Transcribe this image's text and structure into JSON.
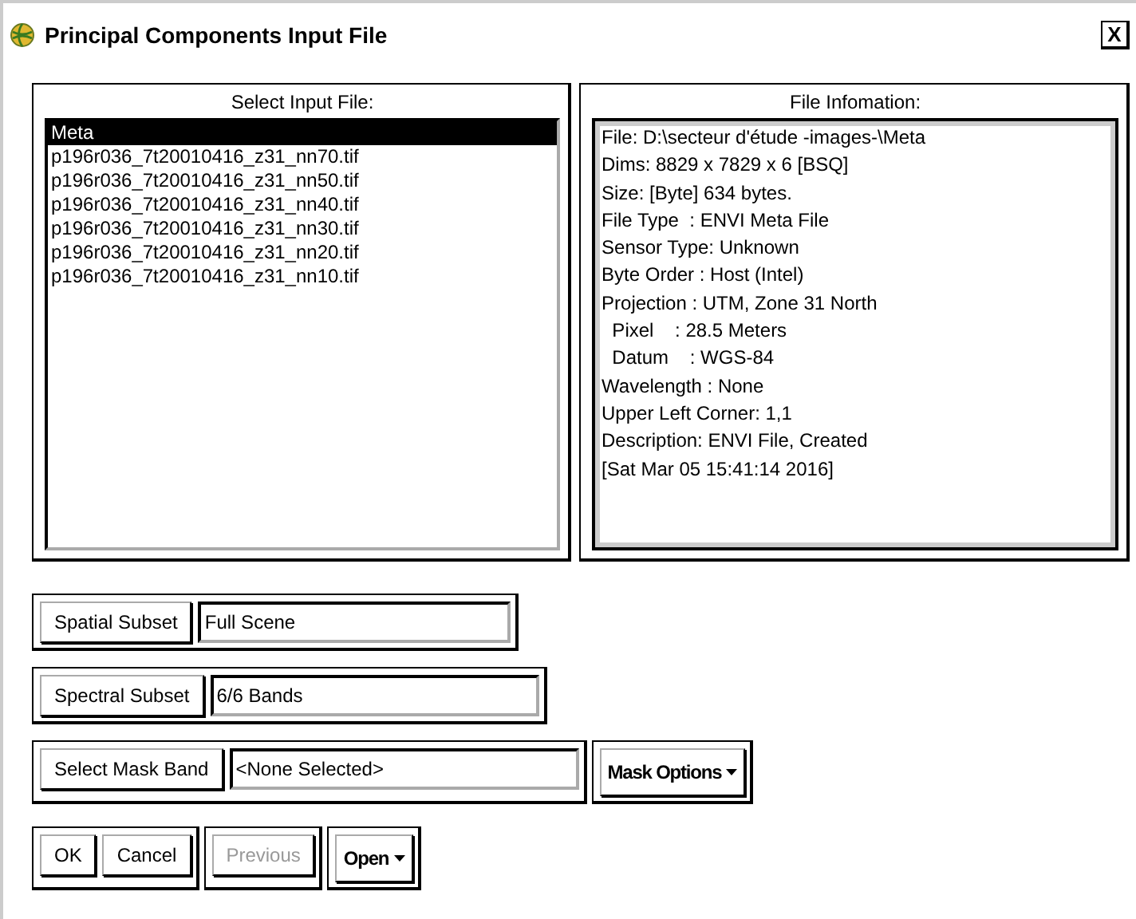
{
  "window": {
    "title": "Principal Components Input File",
    "close": "X"
  },
  "input_files": {
    "heading": "Select Input File:",
    "items": [
      {
        "name": "Meta",
        "selected": true
      },
      {
        "name": "p196r036_7t20010416_z31_nn70.tif",
        "selected": false
      },
      {
        "name": "p196r036_7t20010416_z31_nn50.tif",
        "selected": false
      },
      {
        "name": "p196r036_7t20010416_z31_nn40.tif",
        "selected": false
      },
      {
        "name": "p196r036_7t20010416_z31_nn30.tif",
        "selected": false
      },
      {
        "name": "p196r036_7t20010416_z31_nn20.tif",
        "selected": false
      },
      {
        "name": "p196r036_7t20010416_z31_nn10.tif",
        "selected": false
      }
    ]
  },
  "file_information": {
    "heading": "File Infomation:",
    "lines": [
      "File: D:\\secteur d'étude -images-\\Meta",
      "Dims: 8829 x 7829 x 6 [BSQ]",
      "Size: [Byte] 634 bytes.",
      "File Type  : ENVI Meta File",
      "Sensor Type: Unknown",
      "Byte Order : Host (Intel)",
      "Projection : UTM, Zone 31 North",
      "  Pixel    : 28.5 Meters",
      "  Datum    : WGS-84",
      "Wavelength : None",
      "Upper Left Corner: 1,1",
      "Description: ENVI File, Created",
      "[Sat Mar 05 15:41:14 2016]"
    ]
  },
  "subset_rows": [
    {
      "button": "Spatial Subset",
      "value": "Full Scene"
    },
    {
      "button": "Spectral Subset",
      "value": "6/6 Bands"
    },
    {
      "button": "Select Mask Band",
      "value": "<None Selected>",
      "menu": "Mask Options"
    }
  ],
  "button_groups": [
    [
      {
        "label": "OK",
        "kind": "button",
        "disabled": false
      },
      {
        "label": "Cancel",
        "kind": "button",
        "disabled": false
      }
    ],
    [
      {
        "label": "Previous",
        "kind": "button",
        "disabled": true
      }
    ],
    [
      {
        "label": "Open",
        "kind": "menu",
        "disabled": false
      }
    ]
  ]
}
